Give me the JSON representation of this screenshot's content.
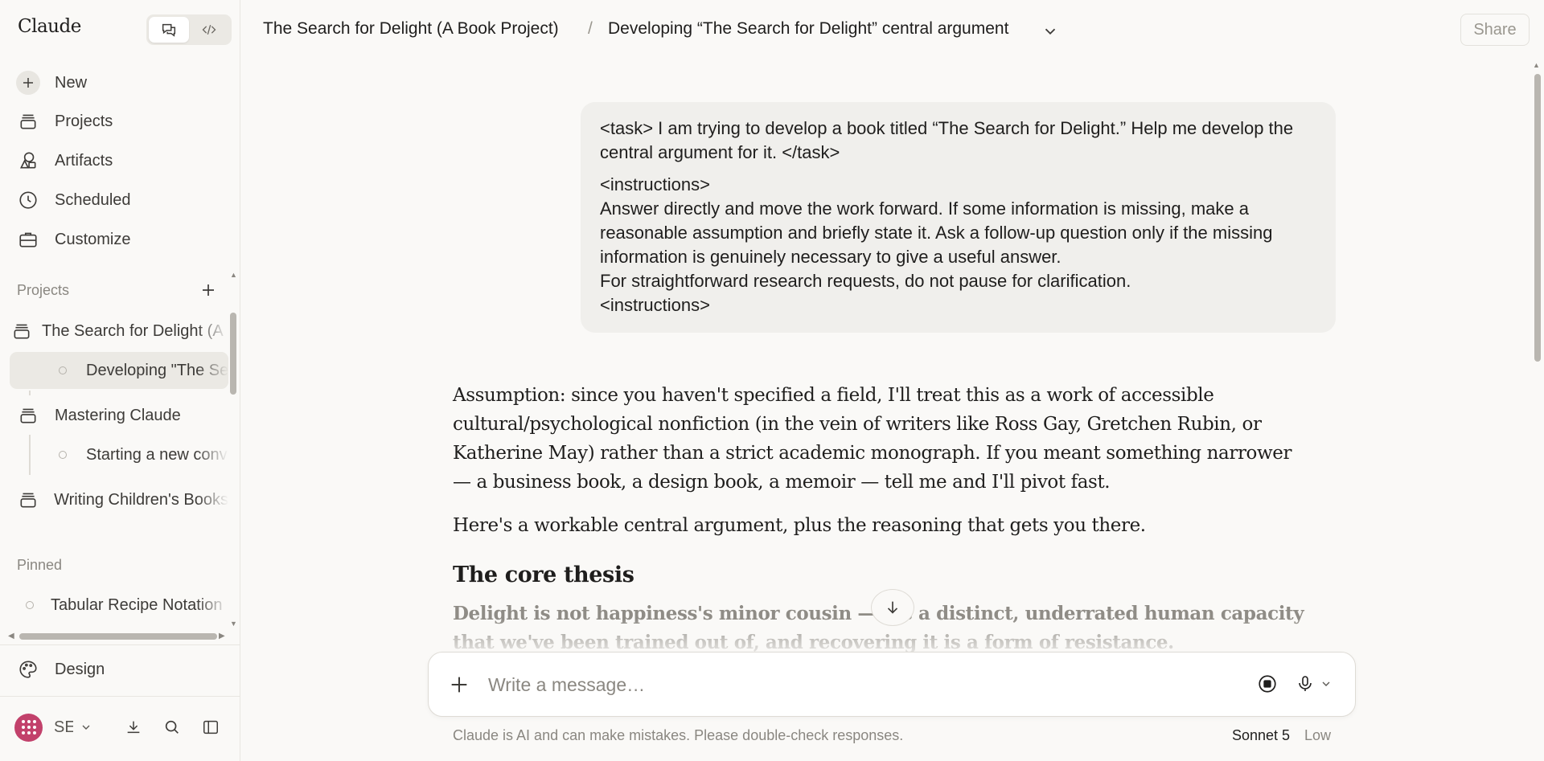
{
  "app": {
    "brand": "Claude"
  },
  "sidebar": {
    "nav": [
      {
        "label": "New",
        "icon": "plus-icon"
      },
      {
        "label": "Projects",
        "icon": "stack-icon"
      },
      {
        "label": "Artifacts",
        "icon": "shapes-icon"
      },
      {
        "label": "Scheduled",
        "icon": "clock-icon"
      },
      {
        "label": "Customize",
        "icon": "briefcase-icon"
      }
    ],
    "projects_label": "Projects",
    "projects": [
      {
        "label": "The Search for Delight (A Book Project)",
        "icon": "stack-icon"
      },
      {
        "label": "Developing \"The Search for Delight\" central argument",
        "icon": "dot-icon"
      },
      {
        "label": "Mastering Claude",
        "icon": "stack-icon"
      },
      {
        "label": "Starting a new conversation",
        "icon": "dot-icon"
      },
      {
        "label": "Writing Children's Books",
        "icon": "stack-icon"
      }
    ],
    "pinned_label": "Pinned",
    "pinned": [
      {
        "label": "Tabular Recipe Notation",
        "icon": "dot-icon"
      }
    ],
    "design_label": "Design",
    "user": {
      "initials": "SE"
    }
  },
  "header": {
    "project_crumb": "The Search for Delight (A Book Project)",
    "separator": "/",
    "chat_crumb": "Developing “The Search for Delight” central argument",
    "share_label": "Share"
  },
  "conversation": {
    "user_message": {
      "task": "<task> I am trying to develop a book titled “The Search for Delight.” Help me develop the central argument for it. </task>",
      "instructions_open": "<instructions>",
      "instructions_body": "Answer directly and move the work forward. If some information is missing, make a reasonable assumption and briefly state it. Ask a follow-up question only if the missing information is genuinely necessary to give a useful answer.",
      "instructions_research": "For straightforward research requests, do not pause for clarification.",
      "instructions_close": "<instructions>"
    },
    "assistant_message": {
      "assumption": "Assumption: since you haven't specified a field, I'll treat this as a work of accessible cultural/psychological nonfiction (in the vein of writers like Ross Gay, Gretchen Rubin, or Katherine May) rather than a strict academic monograph. If you meant something narrower — a business book, a design book, a memoir — tell me and I'll pivot fast.",
      "intro": "Here's a workable central argument, plus the reasoning that gets you there.",
      "heading": "The core thesis",
      "thesis": "Delight is not happiness's minor cousin — it's a distinct, underrated human capacity that we've been trained out of, and recovering it is a form of resistance."
    }
  },
  "composer": {
    "placeholder": "Write a message…",
    "disclaimer": "Claude is AI and can make mistakes. Please double-check responses.",
    "model": "Sonnet 5",
    "effort": "Low"
  }
}
